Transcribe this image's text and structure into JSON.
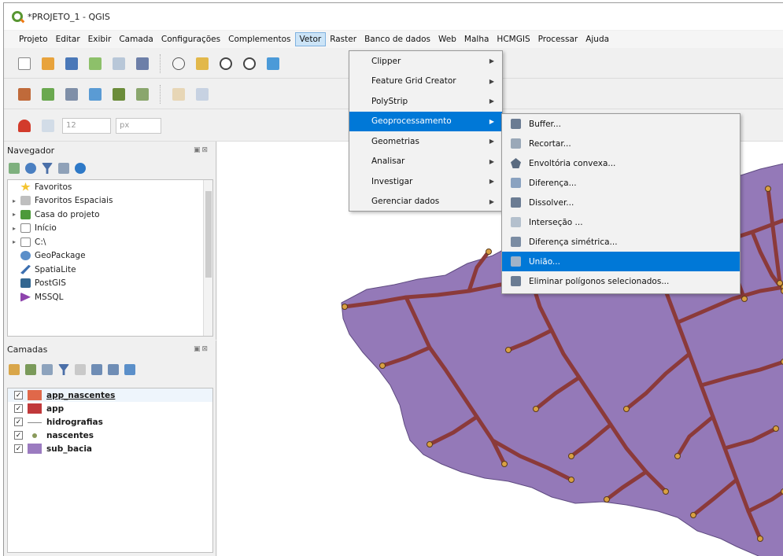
{
  "window": {
    "title": "*PROJETO_1 - QGIS"
  },
  "menubar": {
    "items": [
      "Projeto",
      "Editar",
      "Exibir",
      "Camada",
      "Configurações",
      "Complementos",
      "Vetor",
      "Raster",
      "Banco de dados",
      "Web",
      "Malha",
      "HCMGIS",
      "Processar",
      "Ajuda"
    ],
    "active": "Vetor"
  },
  "toolbar3": {
    "size_value": "12",
    "unit_value": "px"
  },
  "vector_menu": {
    "items": [
      {
        "label": "Clipper"
      },
      {
        "label": "Feature Grid Creator"
      },
      {
        "label": "PolyStrip"
      },
      {
        "label": "Geoprocessamento"
      },
      {
        "label": "Geometrias"
      },
      {
        "label": "Analisar"
      },
      {
        "label": "Investigar"
      },
      {
        "label": "Gerenciar dados"
      }
    ],
    "highlighted": "Geoprocessamento"
  },
  "geoprocessing_menu": {
    "items": [
      {
        "label": "Buffer..."
      },
      {
        "label": "Recortar..."
      },
      {
        "label": "Envoltória convexa..."
      },
      {
        "label": "Diferença..."
      },
      {
        "label": "Dissolver..."
      },
      {
        "label": "Interseção ..."
      },
      {
        "label": "Diferença simétrica..."
      },
      {
        "label": "União..."
      },
      {
        "label": "Eliminar polígonos selecionados..."
      }
    ],
    "highlighted": "União..."
  },
  "browser_panel": {
    "title": "Navegador",
    "items": [
      {
        "label": "Favoritos",
        "icon": "star-icon"
      },
      {
        "label": "Favoritos Espaciais",
        "icon": "spatial-bookmark-icon"
      },
      {
        "label": "Casa do projeto",
        "icon": "project-home-icon"
      },
      {
        "label": "Início",
        "icon": "home-folder-icon"
      },
      {
        "label": "C:\\",
        "icon": "drive-icon"
      },
      {
        "label": "GeoPackage",
        "icon": "geopackage-icon"
      },
      {
        "label": "SpatiaLite",
        "icon": "spatialite-icon"
      },
      {
        "label": "PostGIS",
        "icon": "postgis-icon"
      },
      {
        "label": "MSSQL",
        "icon": "mssql-icon"
      }
    ]
  },
  "layers_panel": {
    "title": "Camadas",
    "layers": [
      {
        "name": "app_nascentes",
        "checked": "✓",
        "color": "#e0684a"
      },
      {
        "name": "app",
        "checked": "✓",
        "color": "#c0393b"
      },
      {
        "name": "hidrografias",
        "checked": "✓",
        "color": "#8a8a8a"
      },
      {
        "name": "nascentes",
        "checked": "✓",
        "color": "#8a9a5b"
      },
      {
        "name": "sub_bacia",
        "checked": "✓",
        "color": "#9b7bc0"
      }
    ]
  },
  "colors": {
    "accent": "#0078d7",
    "basin_fill": "#9479b8",
    "river": "#8b3a3a",
    "springs": "#d9a043"
  }
}
